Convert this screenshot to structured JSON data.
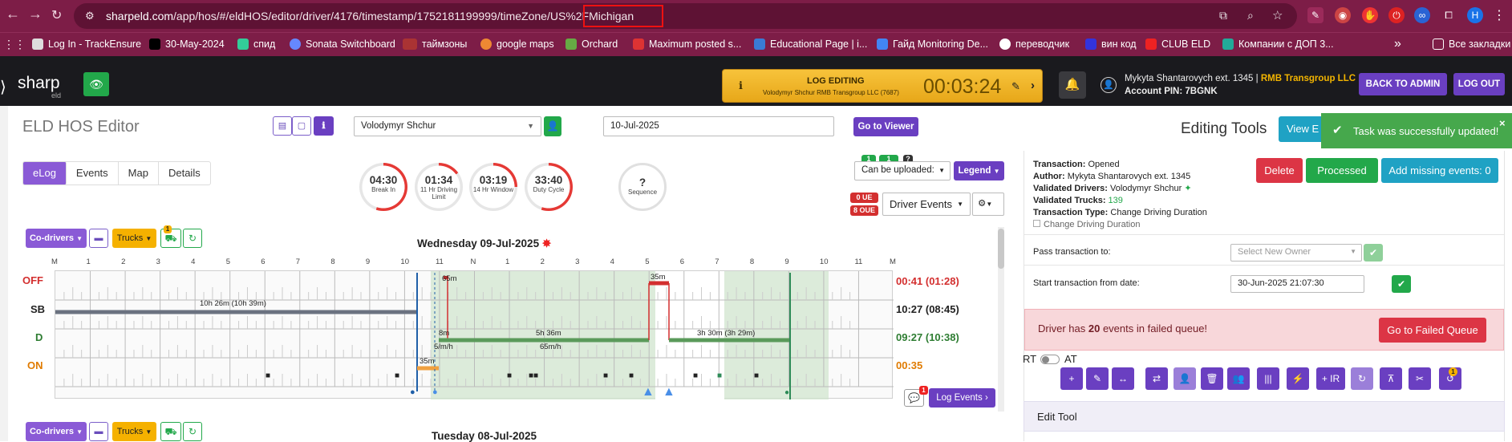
{
  "browser": {
    "url": "sharpeld.com/app/hos/#/eldHOS/editor/driver/4176/timestamp/1752181199999/timeZone/US%2FMichigan",
    "url_domain": "sharpeld.com",
    "url_path": "/app/hos/#/eldHOS/editor/driver/4176/timestamp/1752181199999/timeZone/US",
    "url_tail": "%2FMichigan",
    "profile_letter": "H",
    "bookmarks": [
      "Log In - TrackEnsure",
      "30-May-2024",
      "спид",
      "Sonata Switchboard",
      "таймзоны",
      "google maps",
      "Orchard",
      "Maximum posted s...",
      "Educational Page | i...",
      "Гайд Monitoring De...",
      "переводчик",
      "вин код",
      "CLUB ELD",
      "Компании с ДОП 3..."
    ],
    "bookmarks_more": "»",
    "other_bookmarks": "Все закладки"
  },
  "header": {
    "logo": "sharp",
    "logo_sub": "eld",
    "log_editing_title": "LOG EDITING",
    "log_editing_sub": "Volodymyr Shchur  RMB Transgroup LLC (7687)",
    "log_editing_timer": "00:03:24",
    "account_name": "Mykyta Shantarovych ext. 1345",
    "account_company": "RMB Transgroup LLC",
    "account_pin": "Account PIN: 7BGNK",
    "back_admin": "BACK TO ADMIN",
    "logout": "LOG OUT"
  },
  "editor": {
    "title": "ELD HOS Editor",
    "driver": "Volodymyr Shchur",
    "date": "10-Jul-2025",
    "go_viewer": "Go to Viewer",
    "tabs": [
      "eLog",
      "Events",
      "Map",
      "Details"
    ],
    "gauges": [
      {
        "value": "04:30",
        "label": "Break In",
        "fraction": 0.55
      },
      {
        "value": "01:34",
        "label": "11 Hr Driving Limit",
        "fraction": 0.15
      },
      {
        "value": "03:19",
        "label": "14 Hr Window",
        "fraction": 0.25
      },
      {
        "value": "33:40",
        "label": "Duty Cycle",
        "fraction": 0.55
      }
    ],
    "sequence": {
      "value": "?",
      "label": "Sequence"
    },
    "can_upload_badges": [
      "1",
      "1",
      "?"
    ],
    "can_upload": "Can be uploaded:",
    "legend": "Legend",
    "ue": "0 UE",
    "oue": "8 OUE",
    "driver_events": "Driver Events",
    "codrivers": "Co-drivers",
    "trucks": "Trucks",
    "trucks_badge": "1",
    "day1_title": "Wednesday 09-Jul-2025",
    "day2_title": "Tuesday 08-Jul-2025",
    "hours": [
      "M",
      "1",
      "2",
      "3",
      "4",
      "5",
      "6",
      "7",
      "8",
      "9",
      "10",
      "11",
      "N",
      "1",
      "2",
      "3",
      "4",
      "5",
      "6",
      "7",
      "8",
      "9",
      "10",
      "11",
      "M"
    ],
    "rows": [
      {
        "label": "OFF",
        "color": "#d32f2f",
        "value": "00:41 (01:28)"
      },
      {
        "label": "SB",
        "color": "#222",
        "value": "10:27 (08:45)"
      },
      {
        "label": "D",
        "color": "#2e7d32",
        "value": "09:27 (10:38)"
      },
      {
        "label": "ON",
        "color": "#e07b00",
        "value": "00:35"
      }
    ],
    "annotations": [
      "10h 26m (10h 39m)",
      "65m",
      "35m",
      "5h 36m",
      "3h 30m (3h 29m)",
      "65m/h",
      "8m",
      "5/m/h",
      "35m"
    ],
    "log_events": "Log Events",
    "log_events_badge": "1"
  },
  "right": {
    "editing_tools": "Editing Tools",
    "view_btn": "View E",
    "toast": "Task was successfully updated!",
    "transaction": "Opened",
    "author": "Mykyta Shantarovych ext. 1345",
    "validated_drivers": "Volodymyr Shchur",
    "validated_trucks": "139",
    "transaction_type": "Change Driving Duration",
    "check_label": "Change Driving Duration",
    "k_transaction": "Transaction:",
    "k_author": "Author:",
    "k_vdrivers": "Validated Drivers:",
    "k_vtrucks": "Validated Trucks:",
    "k_ttype": "Transaction Type:",
    "delete": "Delete",
    "processed": "Processed",
    "add_missing": "Add missing events: 0",
    "pass_to": "Pass transaction to:",
    "new_owner_ph": "Select New Owner",
    "start_from": "Start transaction from date:",
    "start_date": "30-Jun-2025 21:07:30",
    "failed_msg_a": "Driver has ",
    "failed_count": "20",
    "failed_msg_b": " events in failed queue!",
    "failed_btn": "Go to Failed Queue",
    "rt": "RT",
    "at": "AT",
    "ir": "+ IR",
    "tool_badge": "1",
    "edit_tool": "Edit Tool"
  }
}
